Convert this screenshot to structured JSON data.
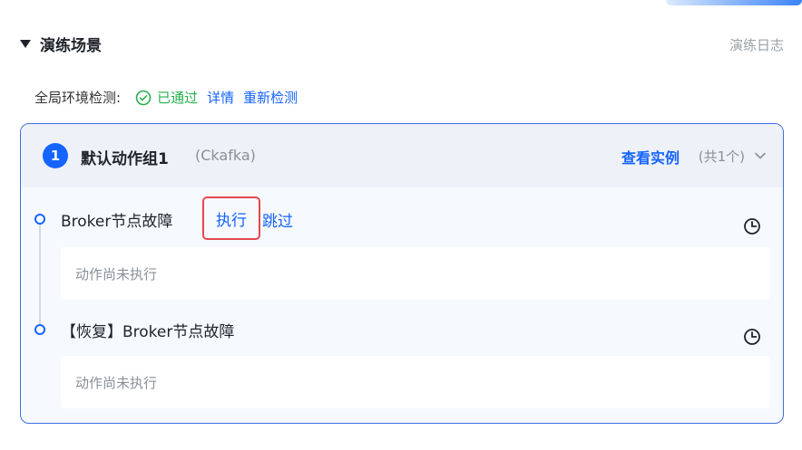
{
  "scenario": {
    "title": "演练场景",
    "log_link": "演练日志"
  },
  "env_check": {
    "label": "全局环境检测:",
    "status": "已通过",
    "details_link": "详情",
    "recheck_link": "重新检测"
  },
  "action_group": {
    "number": "1",
    "title": "默认动作组1",
    "subtitle": "(Ckafka)",
    "view_instances": "查看实例",
    "instance_count": "(共1个)",
    "actions": [
      {
        "name": "Broker节点故障",
        "execute_label": "执行",
        "skip_label": "跳过",
        "status": "动作尚未执行"
      },
      {
        "name": "【恢复】Broker节点故障",
        "status": "动作尚未执行"
      }
    ]
  },
  "icons": {
    "collapse": "triangle-down-icon",
    "passed": "check-circle-icon",
    "expand": "chevron-down-icon",
    "timing": "clock-icon"
  },
  "colors": {
    "accent": "#1664ff",
    "success": "#22b04b",
    "highlight_border": "#e5484d",
    "card_border": "#3e6fe0"
  }
}
